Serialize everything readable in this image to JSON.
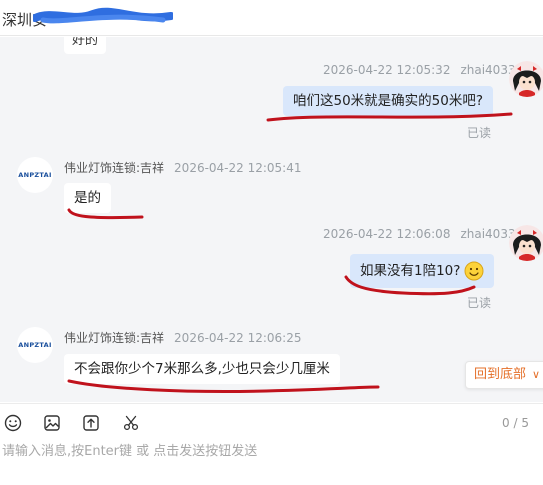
{
  "header": {
    "title": "深圳安"
  },
  "messages_partial": {
    "text": "好的"
  },
  "messages": [
    {
      "direction": "out",
      "timestamp": "2026-04-22 12:05:32",
      "sender": "zhai4033a",
      "text": "咱们这50米就是确实的50米吧?",
      "status": "已读",
      "avatar": "cartoon-avatar"
    },
    {
      "direction": "in",
      "timestamp": "2026-04-22 12:05:41",
      "sender": "伟业灯饰连锁:吉祥",
      "text": "是的",
      "avatar": "ANPZTAI"
    },
    {
      "direction": "out",
      "timestamp": "2026-04-22 12:06:08",
      "sender": "zhai4033a",
      "text": "如果没有1陪10?",
      "emoji": "smile-emoji",
      "status": "已读",
      "avatar": "cartoon-avatar"
    },
    {
      "direction": "in",
      "timestamp": "2026-04-22 12:06:25",
      "sender": "伟业灯饰连锁:吉祥",
      "text": "不会跟你少个7米那么多,少也只会少几厘米",
      "avatar": "ANPZTAI"
    }
  ],
  "back_to_bottom": {
    "label": "回到底部"
  },
  "toolbar": {
    "icons": [
      "emoji-icon",
      "image-icon",
      "upload-icon",
      "scissors-icon"
    ],
    "char_count": "0 / 5"
  },
  "input": {
    "placeholder": "请输入消息,按Enter键 或 点击发送按钮发送"
  },
  "colors": {
    "outgoing_bubble": "#d9e7fb",
    "incoming_bubble": "#ffffff",
    "chat_bg": "#f4f5f7",
    "accent": "#e5702a",
    "annotation": "#c0121c"
  }
}
